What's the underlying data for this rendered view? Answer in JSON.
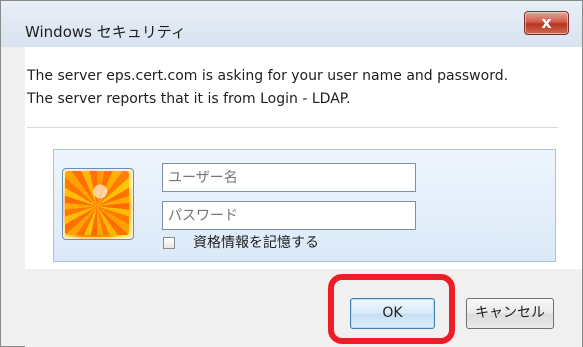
{
  "window": {
    "title": "Windows セキュリティ",
    "close_glyph": "x"
  },
  "message": "The server eps.cert.com is asking for your user name and password. The server reports that it is from Login - LDAP.",
  "fields": {
    "username_placeholder": "ユーザー名",
    "password_placeholder": "パスワード"
  },
  "checkbox": {
    "label": "資格情報を記憶する",
    "checked": false
  },
  "buttons": {
    "ok": "OK",
    "cancel": "キャンセル"
  },
  "colors": {
    "highlight": "#ee1c24",
    "panel_border": "#a8c2e3"
  },
  "icons": {
    "user_tile": "flower-user-tile"
  }
}
